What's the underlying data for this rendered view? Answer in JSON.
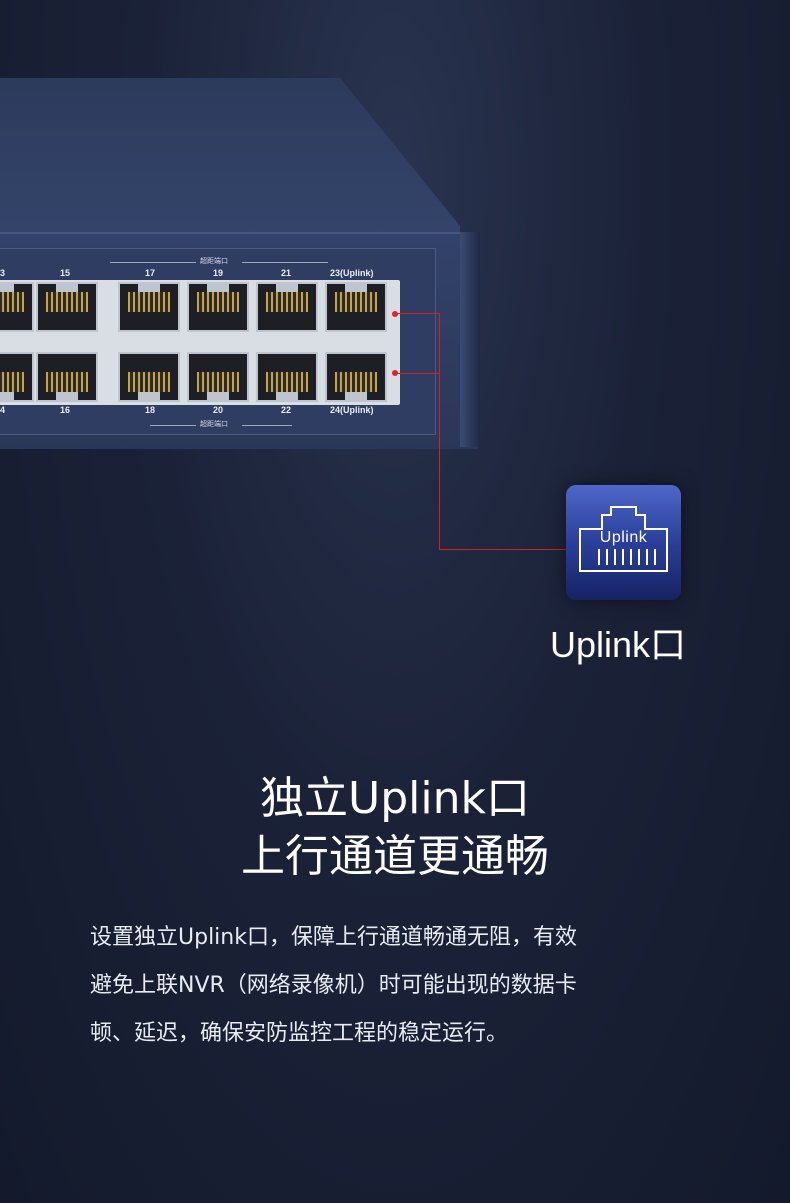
{
  "switch": {
    "port_numbers_top": [
      "3",
      "15",
      "17",
      "19",
      "21",
      "23(Uplink)"
    ],
    "port_numbers_bottom": [
      "4",
      "16",
      "18",
      "20",
      "22",
      "24(Uplink)"
    ],
    "super_distance_label": "超距端口"
  },
  "uplink": {
    "icon_text": "Uplink",
    "caption": "Uplink口"
  },
  "headline": {
    "line1": "独立Uplink口",
    "line2": "上行通道更通畅"
  },
  "body": {
    "line1": "设置独立Uplink口，保障上行通道畅通无阻，有效",
    "line2": "避免上联NVR（网络录像机）时可能出现的数据卡",
    "line3": "顿、延迟，确保安防监控工程的稳定运行。"
  },
  "colors": {
    "background": "#1b2238",
    "accent_red": "#d32020",
    "icon_blue": "#2a3f9a"
  }
}
